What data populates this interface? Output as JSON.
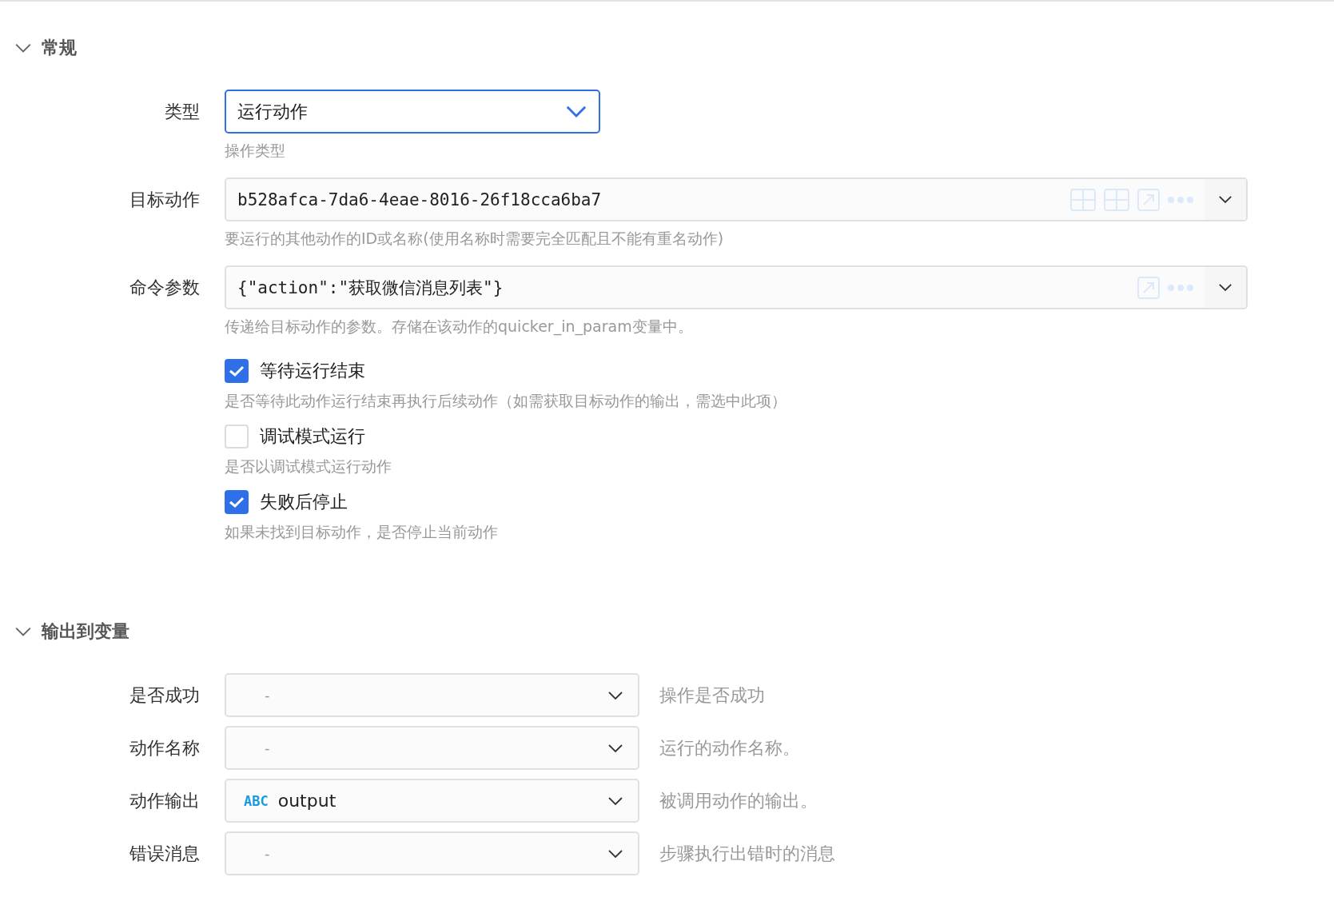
{
  "sections": [
    {
      "kind": "general",
      "title": "常规",
      "expanded": true,
      "fields": [
        {
          "kind": "dropdown",
          "label": "类型",
          "value": "运行动作",
          "hint": "操作类型"
        },
        {
          "kind": "action_picker",
          "label": "目标动作",
          "value": "b528afca-7da6-4eae-8016-26f18cca6ba7",
          "hint": "要运行的其他动作的ID或名称(使用名称时需要完全匹配且不能有重名动作)"
        },
        {
          "kind": "expression",
          "label": "命令参数",
          "value": "{\"action\":\"获取微信消息列表\"}",
          "hint": "传递给目标动作的参数。存储在该动作的quicker_in_param变量中。"
        }
      ],
      "checkboxes": [
        {
          "label": "等待运行结束",
          "checked": true,
          "hint": "是否等待此动作运行结束再执行后续动作（如需获取目标动作的输出，需选中此项）"
        },
        {
          "label": "调试模式运行",
          "checked": false,
          "hint": "是否以调试模式运行动作"
        },
        {
          "label": "失败后停止",
          "checked": true,
          "hint": "如果未找到目标动作，是否停止当前动作"
        }
      ]
    },
    {
      "kind": "output",
      "title": "输出到变量",
      "expanded": true,
      "rows": [
        {
          "label": "是否成功",
          "value": "-",
          "hint": "操作是否成功"
        },
        {
          "label": "动作名称",
          "value": "-",
          "hint": "运行的动作名称。"
        },
        {
          "label": "动作输出",
          "type_badge": "ABC",
          "value": "output",
          "hint": "被调用动作的输出。"
        },
        {
          "label": "错误消息",
          "value": "-",
          "hint": "步骤执行出错时的消息"
        }
      ]
    }
  ]
}
